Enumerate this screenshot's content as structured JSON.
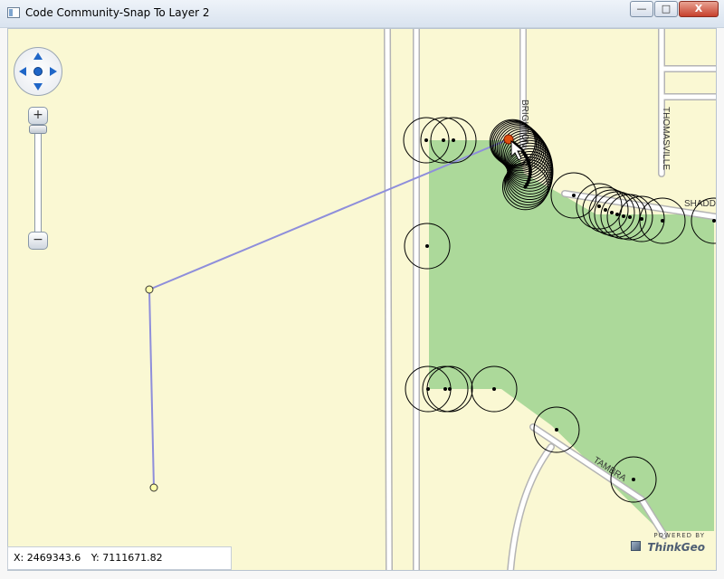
{
  "window": {
    "title": "Code Community-Snap To Layer 2",
    "buttons": {
      "minimize": "—",
      "maximize": "□",
      "close": "X"
    }
  },
  "map": {
    "colors": {
      "land": "#faf8d3",
      "park": "#acd99a",
      "road": "#ffffff",
      "road_outline": "#b4b4b4",
      "edit_line": "#8e8edb",
      "vertex_fill": "#ffffaa",
      "snap_point": "#e05010",
      "circle": "#000000"
    },
    "street_labels": [
      "BRIGHTON",
      "THOMASVILLE",
      "SHADD",
      "TAMBRA"
    ],
    "zoom_control": {
      "plus": "+",
      "minus": "−"
    }
  },
  "status": {
    "x_label": "X: 2469343.6",
    "y_label": "Y: 7111671.82"
  },
  "branding": {
    "powered_by": "POWERED BY",
    "name": "ThinkGeo"
  }
}
